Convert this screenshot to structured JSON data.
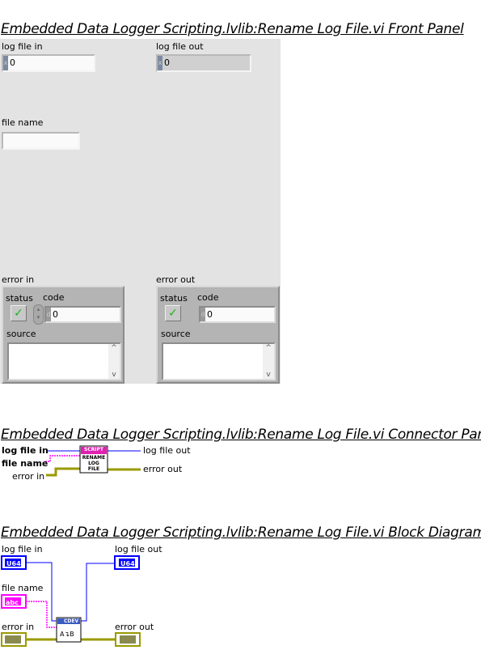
{
  "front_panel": {
    "title": "Embedded Data Logger Scripting.lvlib:Rename Log File.vi Front Panel",
    "log_file_in": {
      "label": "log file in",
      "radix": "x",
      "value": "0"
    },
    "log_file_out": {
      "label": "log file out",
      "radix": "x",
      "value": "0"
    },
    "file_name": {
      "label": "file name",
      "value": ""
    },
    "error_in": {
      "label": "error in",
      "status_label": "status",
      "status": true,
      "code_label": "code",
      "radix": "d",
      "code": "0",
      "source_label": "source",
      "source": ""
    },
    "error_out": {
      "label": "error out",
      "status_label": "status",
      "status": true,
      "code_label": "code",
      "radix": "d",
      "code": "0",
      "source_label": "source",
      "source": ""
    }
  },
  "connector_pane": {
    "title": "Embedded Data Logger Scripting.lvlib:Rename Log File.vi Connector Pane",
    "inputs": [
      "log file in",
      "file name",
      "error in"
    ],
    "outputs": [
      "log file out",
      "error out"
    ],
    "icon_banner": "SCRIPT",
    "icon_text": [
      "RENAME",
      "LOG",
      "FILE"
    ]
  },
  "block_diagram": {
    "title": "Embedded Data Logger Scripting.lvlib:Rename Log File.vi Block Diagram",
    "log_file_in": {
      "label": "log file in",
      "type": "U64"
    },
    "log_file_out": {
      "label": "log file out",
      "type": "U64"
    },
    "file_name": {
      "label": "file name",
      "type": "abc"
    },
    "error_in": {
      "label": "error in"
    },
    "error_out": {
      "label": "error out"
    },
    "subvi_banner": "CDEV"
  },
  "colors": {
    "u64_wire": "#0000ff",
    "string_wire": "#ff00ff",
    "error_wire": "#9a9a00",
    "script_banner": "#e020b0"
  }
}
